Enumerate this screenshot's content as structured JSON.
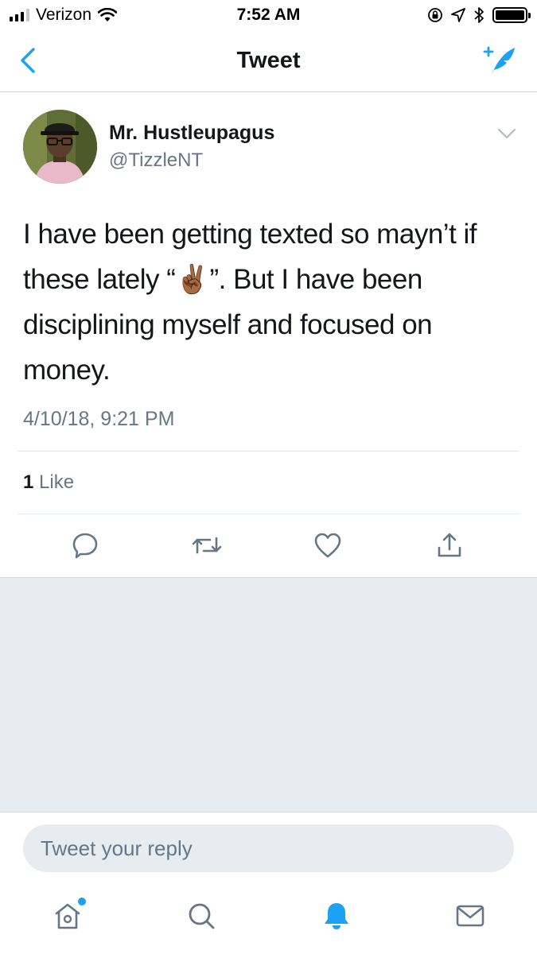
{
  "status_bar": {
    "carrier": "Verizon",
    "time": "7:52 AM"
  },
  "nav": {
    "title": "Tweet"
  },
  "tweet": {
    "display_name": "Mr. Hustleupagus",
    "handle": "@TizzleNT",
    "text": "I have been getting texted so mayn’t if these lately “✌🏾”. But I have been disciplining myself and focused on money.",
    "timestamp": "4/10/18, 9:21 PM",
    "like_count": "1",
    "like_label": "Like"
  },
  "reply": {
    "placeholder": "Tweet your reply"
  },
  "colors": {
    "accent": "#1da1f2",
    "secondary_text": "#657786",
    "icon_gray": "#657786",
    "background_gray": "#e6ecf0"
  },
  "icons": {
    "nav_back": "chevron-left-icon",
    "nav_compose": "compose-feather-icon",
    "caret": "chevron-down-icon",
    "reply": "reply-bubble-icon",
    "retweet": "retweet-icon",
    "like": "heart-icon",
    "share": "share-icon",
    "tab_home": "home-icon",
    "tab_search": "search-icon",
    "tab_notifications": "bell-icon",
    "tab_messages": "envelope-icon"
  }
}
